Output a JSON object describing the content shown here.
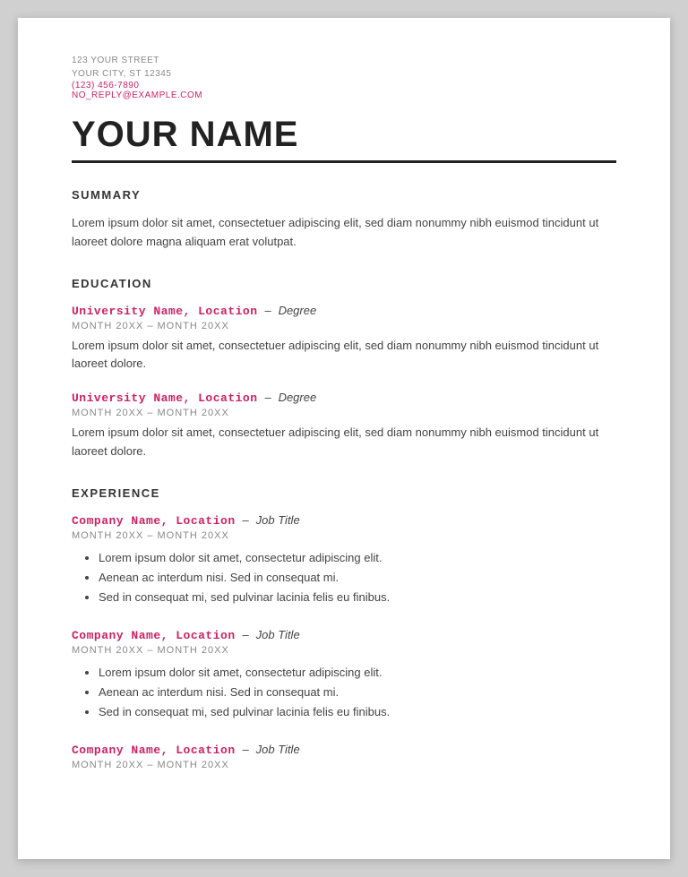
{
  "contact": {
    "line1": "123 YOUR STREET",
    "line2": "YOUR CITY, ST 12345",
    "phone": "(123) 456-7890",
    "email": "NO_REPLY@EXAMPLE.COM"
  },
  "name": "YOUR NAME",
  "sections": {
    "summary": {
      "title": "Summary",
      "text": "Lorem ipsum dolor sit amet, consectetuer adipiscing elit, sed diam nonummy nibh euismod tincidunt ut laoreet dolore magna aliquam erat volutpat."
    },
    "education": {
      "title": "Education",
      "entries": [
        {
          "school": "University Name, Location",
          "dash": "–",
          "degree": "Degree",
          "dates": "MONTH 20XX – MONTH 20XX",
          "desc": "Lorem ipsum dolor sit amet, consectetuer adipiscing elit, sed diam nonummy nibh euismod tincidunt ut laoreet dolore."
        },
        {
          "school": "University Name, Location",
          "dash": "–",
          "degree": "Degree",
          "dates": "MONTH 20XX – MONTH 20XX",
          "desc": "Lorem ipsum dolor sit amet, consectetuer adipiscing elit, sed diam nonummy nibh euismod tincidunt ut laoreet dolore."
        }
      ]
    },
    "experience": {
      "title": "Experience",
      "entries": [
        {
          "company": "Company Name, Location",
          "dash": "–",
          "jobtitle": "Job Title",
          "dates": "MONTH 20XX – MONTH 20XX",
          "bullets": [
            "Lorem ipsum dolor sit amet, consectetur adipiscing elit.",
            "Aenean ac interdum nisi. Sed in consequat mi.",
            "Sed in consequat mi, sed pulvinar lacinia felis eu finibus."
          ]
        },
        {
          "company": "Company Name, Location",
          "dash": "–",
          "jobtitle": "Job Title",
          "dates": "MONTH 20XX – MONTH 20XX",
          "bullets": [
            "Lorem ipsum dolor sit amet, consectetur adipiscing elit.",
            "Aenean ac interdum nisi. Sed in consequat mi.",
            "Sed in consequat mi, sed pulvinar lacinia felis eu finibus."
          ]
        },
        {
          "company": "Company Name, Location",
          "dash": "–",
          "jobtitle": "Job Title",
          "dates": "MONTH 20XX – MONTH 20XX",
          "bullets": []
        }
      ]
    }
  }
}
